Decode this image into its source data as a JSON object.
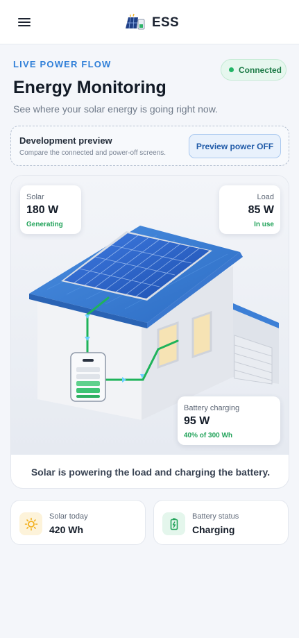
{
  "app": {
    "brand_name": "ESS",
    "logo_icon": "solar-battery-logo-icon",
    "menu_icon": "hamburger-menu-icon"
  },
  "header": {
    "eyebrow": "LIVE POWER FLOW",
    "title": "Energy Monitoring",
    "subtitle": "See where your solar energy is going right now.",
    "status": {
      "text": "Connected",
      "color": "#22b566"
    }
  },
  "dev_preview": {
    "title": "Development preview",
    "description": "Compare the connected and power-off screens.",
    "button_label": "Preview power OFF"
  },
  "flow": {
    "solar": {
      "label": "Solar",
      "value": "180 W",
      "status": "Generating"
    },
    "load": {
      "label": "Load",
      "value": "85 W",
      "status": "In use"
    },
    "battery": {
      "label": "Battery charging",
      "value": "95 W",
      "detail": "40% of 300 Wh"
    },
    "caption": "Solar is powering the load and charging the battery.",
    "flow_line_color": "#1fb35a",
    "battery_charge_level_segments": 3,
    "battery_total_segments": 5
  },
  "summary": [
    {
      "label": "Solar today",
      "value": "420 Wh",
      "icon": "sun-icon",
      "accent": "#f2b01e"
    },
    {
      "label": "Battery status",
      "value": "Charging",
      "icon": "battery-charging-icon",
      "accent": "#22a35a"
    }
  ]
}
